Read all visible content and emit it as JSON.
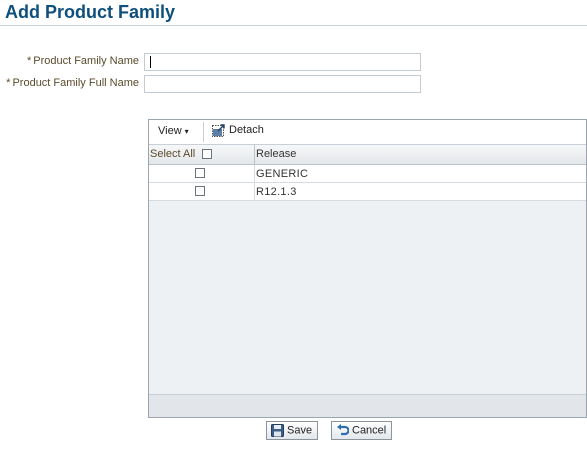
{
  "page": {
    "title": "Add Product Family"
  },
  "form": {
    "required_marker": "*",
    "family_name": {
      "label": "Product Family Name",
      "value": ""
    },
    "family_full_name": {
      "label": "Product Family Full Name",
      "value": ""
    }
  },
  "toolbar": {
    "view_label": "View",
    "view_arrow": "▾",
    "detach_label": "Detach"
  },
  "table": {
    "select_all_label": "Select All",
    "columns": [
      "Release"
    ],
    "rows": [
      {
        "release": "GENERIC",
        "checked": false
      },
      {
        "release": "R12.1.3",
        "checked": false
      }
    ]
  },
  "actions": {
    "save_label": "Save",
    "cancel_label": "Cancel"
  },
  "colors": {
    "title": "#0e4f7d",
    "label": "#5a4a2b",
    "panel_bg": "#eef1f4"
  }
}
